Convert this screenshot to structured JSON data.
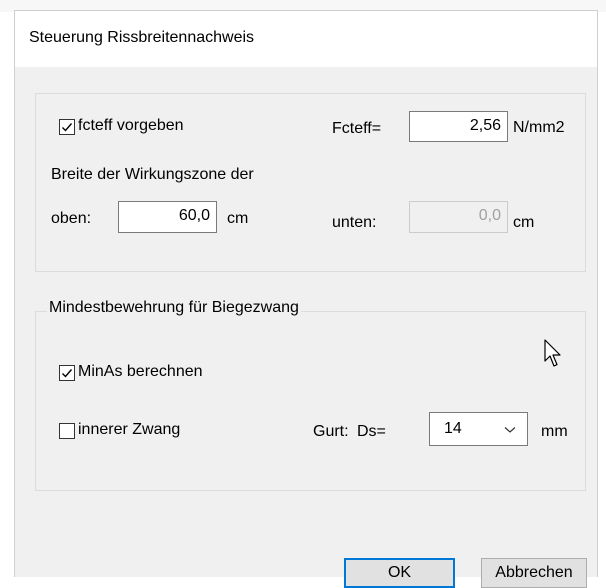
{
  "dialog": {
    "title": "Steuerung Rissbreitennachweis"
  },
  "section1": {
    "fcteff_checkbox": {
      "label": "fcteff  vorgeben",
      "checked": true
    },
    "fcteff_label": "Fcteff=",
    "fcteff_value": "2,56",
    "fcteff_unit": "N/mm2",
    "zone_label": "Breite der Wirkungszone der",
    "oben_label": "oben:",
    "oben_value": "60,0",
    "oben_unit": "cm",
    "unten_label": "unten:",
    "unten_value": "0,0",
    "unten_unit": "cm"
  },
  "section2": {
    "group_title": "Mindestbewehrung für Biegezwang",
    "minas_checkbox": {
      "label": "MinAs berechnen",
      "checked": true
    },
    "zwang_checkbox": {
      "label": "innerer Zwang",
      "checked": false
    },
    "gurt_label": "Gurt:",
    "ds_label": "Ds=",
    "ds_value": "14",
    "ds_unit": "mm"
  },
  "buttons": {
    "ok_label": "OK",
    "cancel_label": "Abbrechen"
  }
}
